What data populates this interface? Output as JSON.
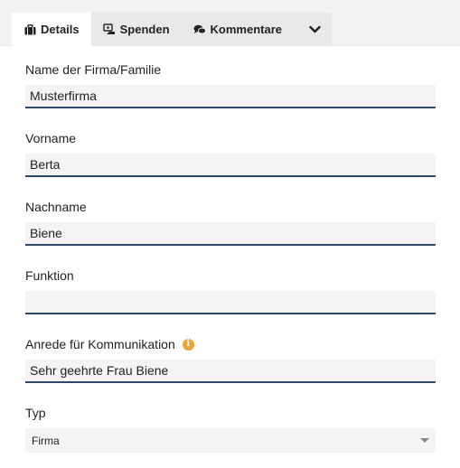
{
  "tabs": [
    {
      "label": "Details",
      "icon": "briefcase-icon"
    },
    {
      "label": "Spenden",
      "icon": "donation-icon"
    },
    {
      "label": "Kommentare",
      "icon": "comments-icon"
    }
  ],
  "fields": {
    "firma": {
      "label": "Name der Firma/Familie",
      "value": "Musterfirma"
    },
    "vorname": {
      "label": "Vorname",
      "value": "Berta"
    },
    "nachname": {
      "label": "Nachname",
      "value": "Biene"
    },
    "funktion": {
      "label": "Funktion",
      "value": ""
    },
    "anrede": {
      "label": "Anrede für Kommunikation",
      "value": "Sehr geehrte Frau Biene"
    },
    "typ": {
      "label": "Typ",
      "value": "Firma"
    }
  },
  "colors": {
    "input_underline": "#2f4865",
    "info_icon": "#f0a33a"
  }
}
